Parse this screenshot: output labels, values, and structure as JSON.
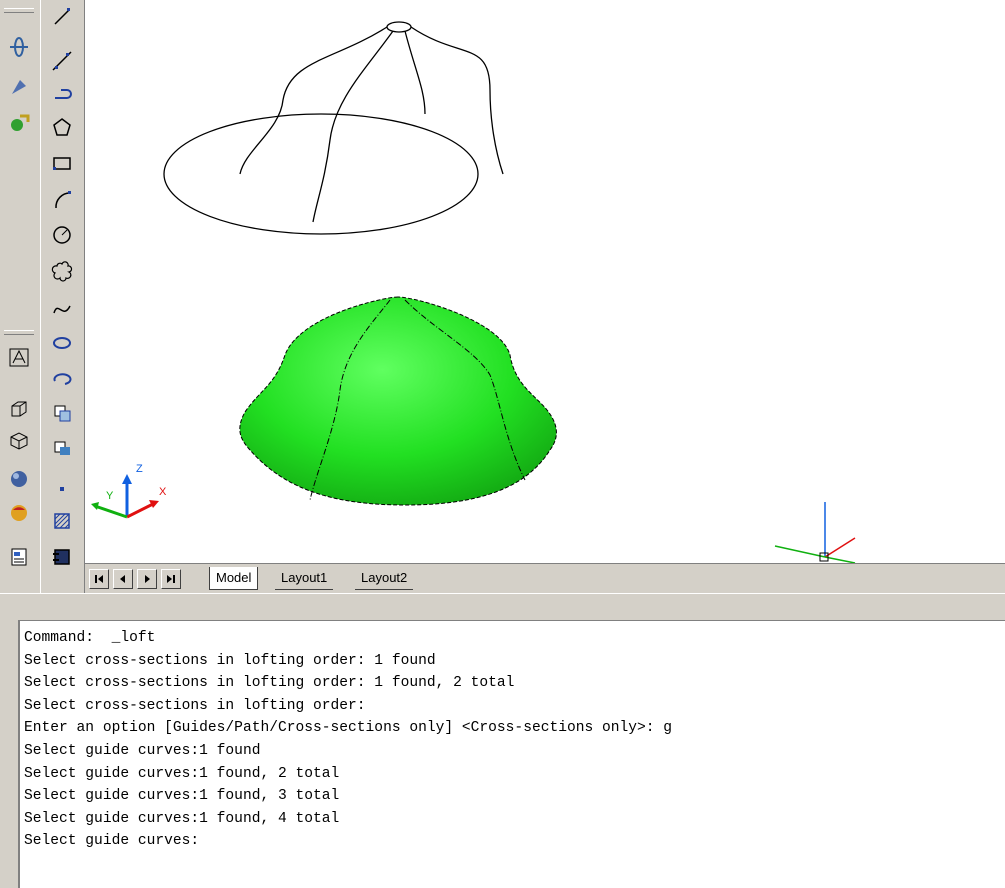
{
  "toolbar_left": {
    "icons": [
      "orbit-icon",
      "light-icon",
      "render-icon",
      "text-style-icon",
      "box-icon",
      "wedge-icon",
      "sphere-icon",
      "material-icon",
      "properties-icon"
    ]
  },
  "toolbar_draw": {
    "icons": [
      "line-icon",
      "construction-line-icon",
      "polyline-icon",
      "polygon-icon",
      "rectangle-icon",
      "arc-icon",
      "circle-icon",
      "revision-cloud-icon",
      "spline-icon",
      "ellipse-icon",
      "ellipse-arc-icon",
      "insert-block-icon",
      "make-block-icon",
      "point-icon",
      "hatch-icon",
      "gradient-icon"
    ]
  },
  "tabs": {
    "model": "Model",
    "layout1": "Layout1",
    "layout2": "Layout2"
  },
  "ucs": {
    "x": "X",
    "y": "Y",
    "z": "Z"
  },
  "colors": {
    "solid_fill": "#22e022",
    "axis_x": "#e01010",
    "axis_y": "#10b010",
    "axis_z": "#1060e0"
  },
  "command": {
    "lines": [
      "Command:  _loft",
      "Select cross-sections in lofting order: 1 found",
      "Select cross-sections in lofting order: 1 found, 2 total",
      "Select cross-sections in lofting order:",
      "Enter an option [Guides/Path/Cross-sections only] <Cross-sections only>: g",
      "Select guide curves:1 found",
      "Select guide curves:1 found, 2 total",
      "Select guide curves:1 found, 3 total",
      "Select guide curves:1 found, 4 total",
      "Select guide curves:"
    ]
  }
}
